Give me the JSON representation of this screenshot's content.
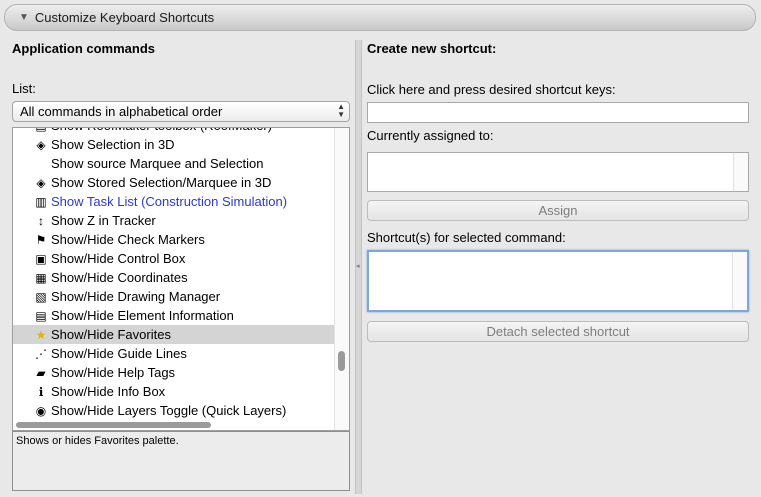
{
  "header": {
    "title": "Customize Keyboard Shortcuts"
  },
  "left": {
    "section_title": "Application commands",
    "list_label": "List:",
    "dropdown_value": "All commands in alphabetical order",
    "rows": [
      {
        "label": "Show RoofMaker toolbox (RoofMaker)",
        "icon": "roof-icon",
        "glyph": "▤",
        "link": false,
        "selected": false
      },
      {
        "label": "Show Selection in 3D",
        "icon": "selection-3d-icon",
        "glyph": "◈",
        "link": false,
        "selected": false
      },
      {
        "label": "Show source Marquee and Selection",
        "icon": "",
        "glyph": "",
        "link": false,
        "selected": false
      },
      {
        "label": "Show Stored Selection/Marquee in 3D",
        "icon": "stored-selection-icon",
        "glyph": "◈",
        "link": false,
        "selected": false
      },
      {
        "label": "Show Task List (Construction Simulation)",
        "icon": "task-list-icon",
        "glyph": "▥",
        "link": true,
        "selected": false
      },
      {
        "label": "Show Z in Tracker",
        "icon": "z-tracker-icon",
        "glyph": "↕",
        "link": false,
        "selected": false
      },
      {
        "label": "Show/Hide Check Markers",
        "icon": "check-markers-icon",
        "glyph": "⚑",
        "link": false,
        "selected": false
      },
      {
        "label": "Show/Hide Control Box",
        "icon": "control-box-icon",
        "glyph": "▣",
        "link": false,
        "selected": false
      },
      {
        "label": "Show/Hide Coordinates",
        "icon": "coordinates-icon",
        "glyph": "▦",
        "link": false,
        "selected": false
      },
      {
        "label": "Show/Hide Drawing Manager",
        "icon": "drawing-manager-icon",
        "glyph": "▧",
        "link": false,
        "selected": false
      },
      {
        "label": "Show/Hide Element Information",
        "icon": "element-info-icon",
        "glyph": "▤",
        "link": false,
        "selected": false
      },
      {
        "label": "Show/Hide Favorites",
        "icon": "favorites-star-icon",
        "glyph": "★",
        "link": false,
        "selected": true
      },
      {
        "label": "Show/Hide Guide Lines",
        "icon": "guide-lines-icon",
        "glyph": "⋰",
        "link": false,
        "selected": false
      },
      {
        "label": "Show/Hide Help Tags",
        "icon": "help-tags-icon",
        "glyph": "▰",
        "link": false,
        "selected": false
      },
      {
        "label": "Show/Hide Info Box",
        "icon": "info-box-icon",
        "glyph": "ℹ",
        "link": false,
        "selected": false
      },
      {
        "label": "Show/Hide Layers Toggle (Quick Layers)",
        "icon": "quick-layers-icon",
        "glyph": "◉",
        "link": false,
        "selected": false
      }
    ],
    "description": "Shows or hides Favorites palette."
  },
  "right": {
    "section_title": "Create new shortcut:",
    "press_keys_label": "Click here and press desired shortcut keys:",
    "press_keys_value": "",
    "currently_assigned_label": "Currently assigned to:",
    "currently_assigned_value": "",
    "assign_button": "Assign",
    "shortcuts_for_selected_label": "Shortcut(s) for selected command:",
    "shortcuts_for_selected_value": "",
    "detach_button": "Detach selected shortcut"
  },
  "colors": {
    "link": "#2f38c9",
    "selected_row": "#d4d4d4",
    "focus_ring": "#7ea7d8"
  }
}
